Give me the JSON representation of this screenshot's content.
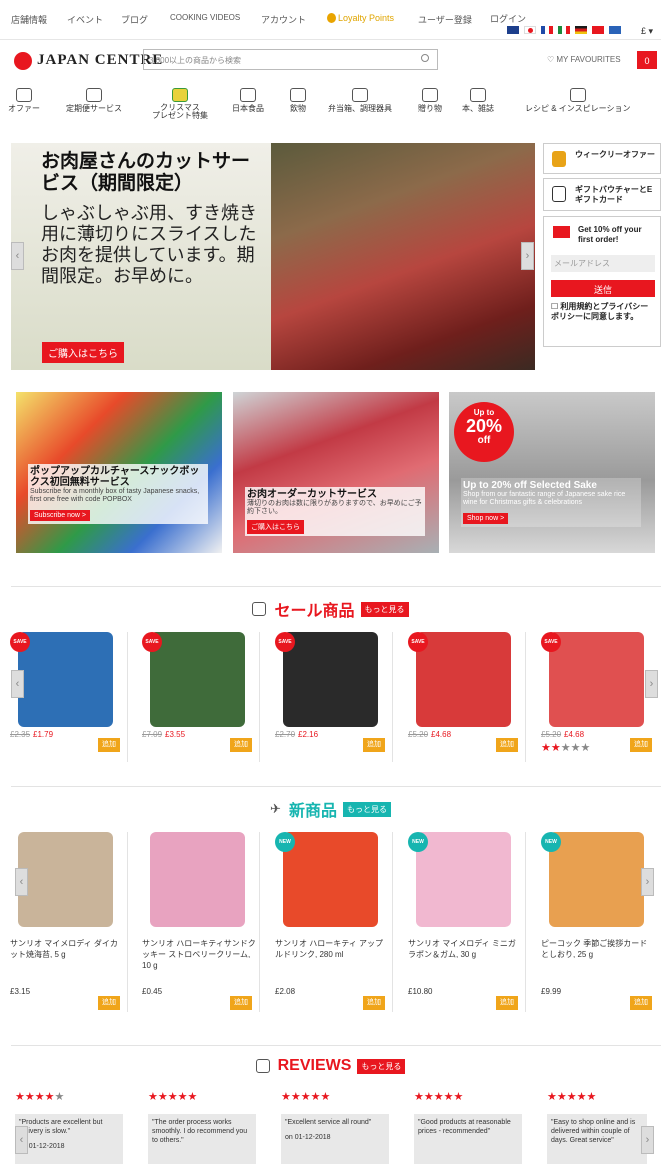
{
  "topbar": {
    "links": [
      "店舗情報",
      "イベント",
      "ブログ",
      "COOKING VIDEOS",
      "アカウント"
    ],
    "loyalty": "Loyalty Points",
    "register": "ユーザー登録",
    "login": "ログイン",
    "currency": "£ ▾"
  },
  "header": {
    "logo": "JAPAN CENTRE",
    "search_placeholder": "3,000以上の商品から検索",
    "favourites": "♡ MY FAVOURITES",
    "cart_count": "0"
  },
  "nav": [
    {
      "label": "オファー"
    },
    {
      "label": "定期便サービス"
    },
    {
      "label": "クリスマス\nプレゼント特集"
    },
    {
      "label": "日本食品"
    },
    {
      "label": "飲物"
    },
    {
      "label": "弁当箱、調理器具"
    },
    {
      "label": "贈り物"
    },
    {
      "label": "本、雑誌"
    },
    {
      "label": "レシピ & インスピレーション"
    }
  ],
  "hero": {
    "title": "お肉屋さんのカットサービス（期間限定）",
    "body": "しゃぶしゃぶ用、すき焼き用に薄切りにスライスしたお肉を提供しています。期間限定。お早めに。",
    "cta": "ご購入はこちら"
  },
  "sidebar": {
    "weekly": "ウィークリーオファー",
    "gift": "ギフトバウチャーとEギフトカード",
    "signup_title": "Get 10% off your first order!",
    "email_placeholder": "メールアドレス",
    "submit": "送信",
    "terms": "☐ 利用規約とプライバシーポリシーに同意します。"
  },
  "promos": [
    {
      "title": "ポップアップカルチャースナックボックス初回無料サービス",
      "desc": "Subscribe for a monthly box of tasty Japanese snacks, first one free with code POPBOX",
      "cta": "Subscribe now >"
    },
    {
      "title": "お肉オーダーカットサービス",
      "desc": "薄切りのお肉は数に限りがありますので、お早めにご予約下さい。",
      "cta": "ご購入はこちら"
    },
    {
      "title": "Up to 20% off Selected Sake",
      "desc": "Shop from our fantastic range of Japanese sake rice wine for Christmas gifts & celebrations",
      "cta": "Shop now >",
      "badge_top": "Up to",
      "badge_big": "20%",
      "badge_bottom": "off"
    }
  ],
  "sale": {
    "title": "セール商品",
    "more": "もっと見る",
    "badge": "SAVE",
    "add": "追加",
    "items": [
      {
        "old": "£2.35",
        "new": "£1.79",
        "color": "#2d6fb5"
      },
      {
        "old": "£7.09",
        "new": "£3.55",
        "color": "#3f6b3a"
      },
      {
        "old": "£2.70",
        "new": "£2.16",
        "color": "#2a2a2a"
      },
      {
        "old": "£5.20",
        "new": "£4.68",
        "color": "#d83a3a"
      },
      {
        "old": "£5.20",
        "new": "£4.68",
        "color": "#e05050",
        "rating": "★★",
        "rating_grey": "★★★"
      }
    ]
  },
  "new": {
    "title": "新商品",
    "more": "もっと見る",
    "badge": "NEW",
    "add": "追加",
    "items": [
      {
        "name": "サンリオ マイメロディ ダイカット焼海苔, 5 g",
        "price": "£3.15",
        "color": "#c9b49a"
      },
      {
        "name": "サンリオ ハローキティサンドクッキー ストロベリークリーム, 10 g",
        "price": "£0.45",
        "color": "#e8a3c0"
      },
      {
        "name": "サンリオ ハローキティ アップルドリンク, 280 ml",
        "price": "£2.08",
        "color": "#e84a2a"
      },
      {
        "name": "サンリオ マイメロディ ミニガラポン＆ガム, 30 g",
        "price": "£10.80",
        "color": "#f1b8d0"
      },
      {
        "name": "ピーコック 季節ご挨拶カードとしおり, 25 g",
        "price": "£9.99",
        "color": "#e8a050"
      }
    ]
  },
  "reviews": {
    "title": "REVIEWS",
    "more": "もっと見る",
    "items": [
      {
        "stars": "★★★★",
        "grey": "★",
        "quote": "\"Products are excellent but delivery is slow.\"",
        "date": "on 01-12-2018"
      },
      {
        "stars": "★★★★★",
        "grey": "",
        "quote": "\"The order process works smoothly. I do recommend you to others.\"",
        "date": ""
      },
      {
        "stars": "★★★★★",
        "grey": "",
        "quote": "\"Excellent service all round\"",
        "date": "on 01-12-2018"
      },
      {
        "stars": "★★★★★",
        "grey": "",
        "quote": "\"Good products at reasonable prices - recommended\"",
        "date": ""
      },
      {
        "stars": "★★★★★",
        "grey": "",
        "quote": "\"Easy to shop online and is delivered within couple of days. Great service\"",
        "date": ""
      }
    ]
  }
}
